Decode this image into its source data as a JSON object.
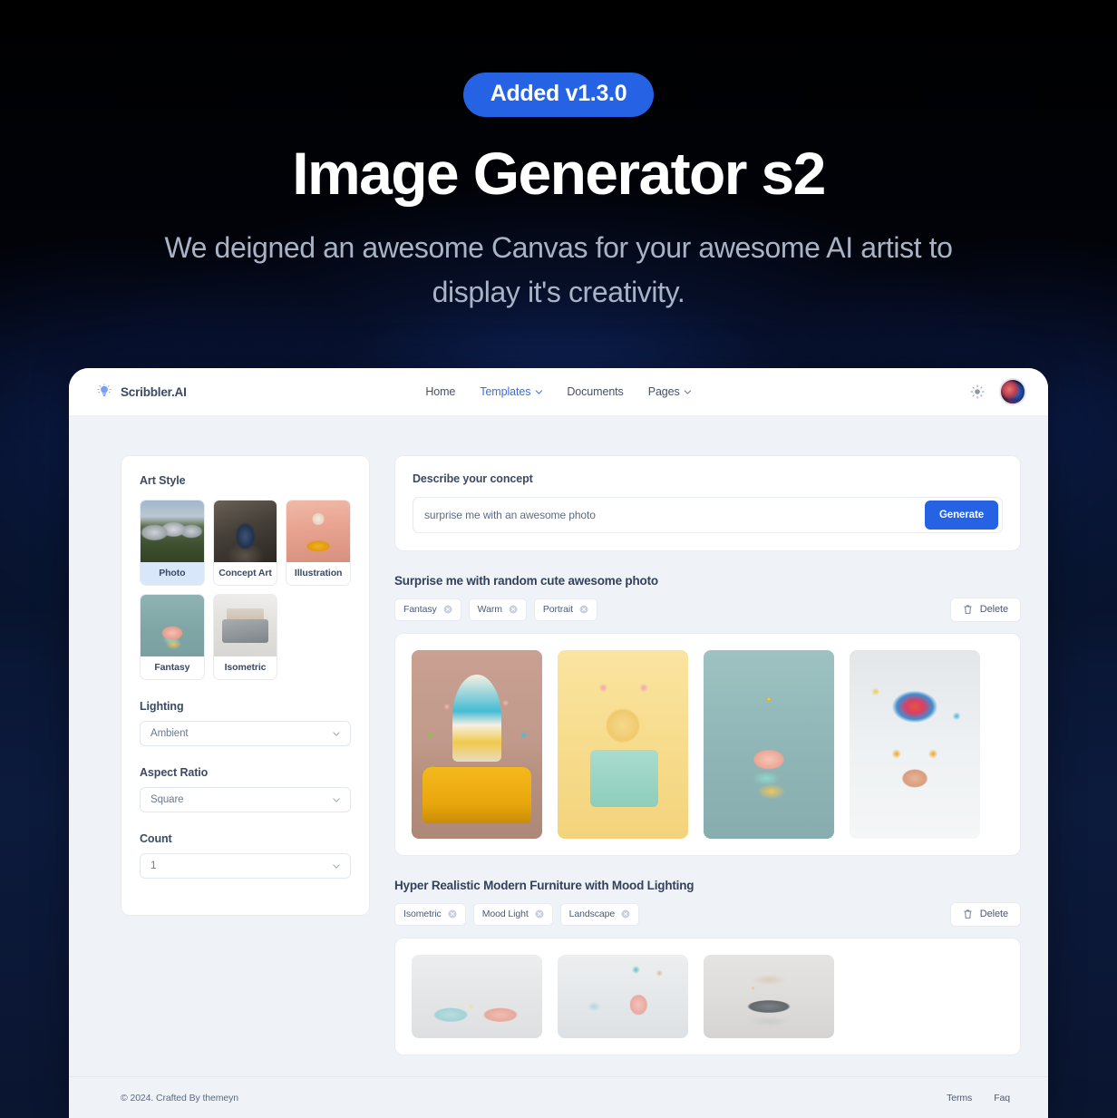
{
  "hero": {
    "badge": "Added v1.3.0",
    "title": "Image Generator s2",
    "subtitle": "We deigned an awesome Canvas for your awesome AI artist to display it's creativity."
  },
  "nav": {
    "brand": "Scribbler.AI",
    "brand_icon": "lightbulb-icon",
    "items": [
      {
        "label": "Home",
        "active": false,
        "caret": false
      },
      {
        "label": "Templates",
        "active": true,
        "caret": true
      },
      {
        "label": "Documents",
        "active": false,
        "caret": false
      },
      {
        "label": "Pages",
        "active": false,
        "caret": true
      }
    ],
    "theme_toggle_icon": "sun-icon",
    "avatar_icon": "user-avatar"
  },
  "sidebar": {
    "art_style_label": "Art Style",
    "styles": [
      {
        "label": "Photo",
        "selected": true
      },
      {
        "label": "Concept Art",
        "selected": false
      },
      {
        "label": "Illustration",
        "selected": false
      },
      {
        "label": "Fantasy",
        "selected": false
      },
      {
        "label": "Isometric",
        "selected": false
      }
    ],
    "lighting": {
      "label": "Lighting",
      "value": "Ambient"
    },
    "aspect_ratio": {
      "label": "Aspect Ratio",
      "value": "Square"
    },
    "count": {
      "label": "Count",
      "value": "1"
    }
  },
  "concept": {
    "label": "Describe your concept",
    "input_value": "surprise me with an awesome photo",
    "input_placeholder": "surprise me with an awesome photo",
    "generate_label": "Generate"
  },
  "results": [
    {
      "title": "Surprise me with random cute awesome photo",
      "tags": [
        "Fantasy",
        "Warm",
        "Portrait"
      ],
      "delete_label": "Delete",
      "images": [
        "ice-cream-car",
        "toy-cat-phone",
        "candle-pastry",
        "colorful-head-portrait"
      ]
    },
    {
      "title": "Hyper Realistic Modern Furniture with Mood Lighting",
      "tags": [
        "Isometric",
        "Mood Light",
        "Landscape"
      ],
      "delete_label": "Delete",
      "images": [
        "pastel-sofa-room",
        "pink-armchair-room",
        "grey-modern-bed"
      ]
    }
  ],
  "footer": {
    "copyright": "© 2024. Crafted By themeyn",
    "links": [
      "Terms",
      "Faq"
    ]
  },
  "colors": {
    "accent": "#2563e4",
    "page_bg": "#eff3f8",
    "card_bg": "#ffffff",
    "selected_chip": "#d9e7fb",
    "heading": "#33415a"
  }
}
